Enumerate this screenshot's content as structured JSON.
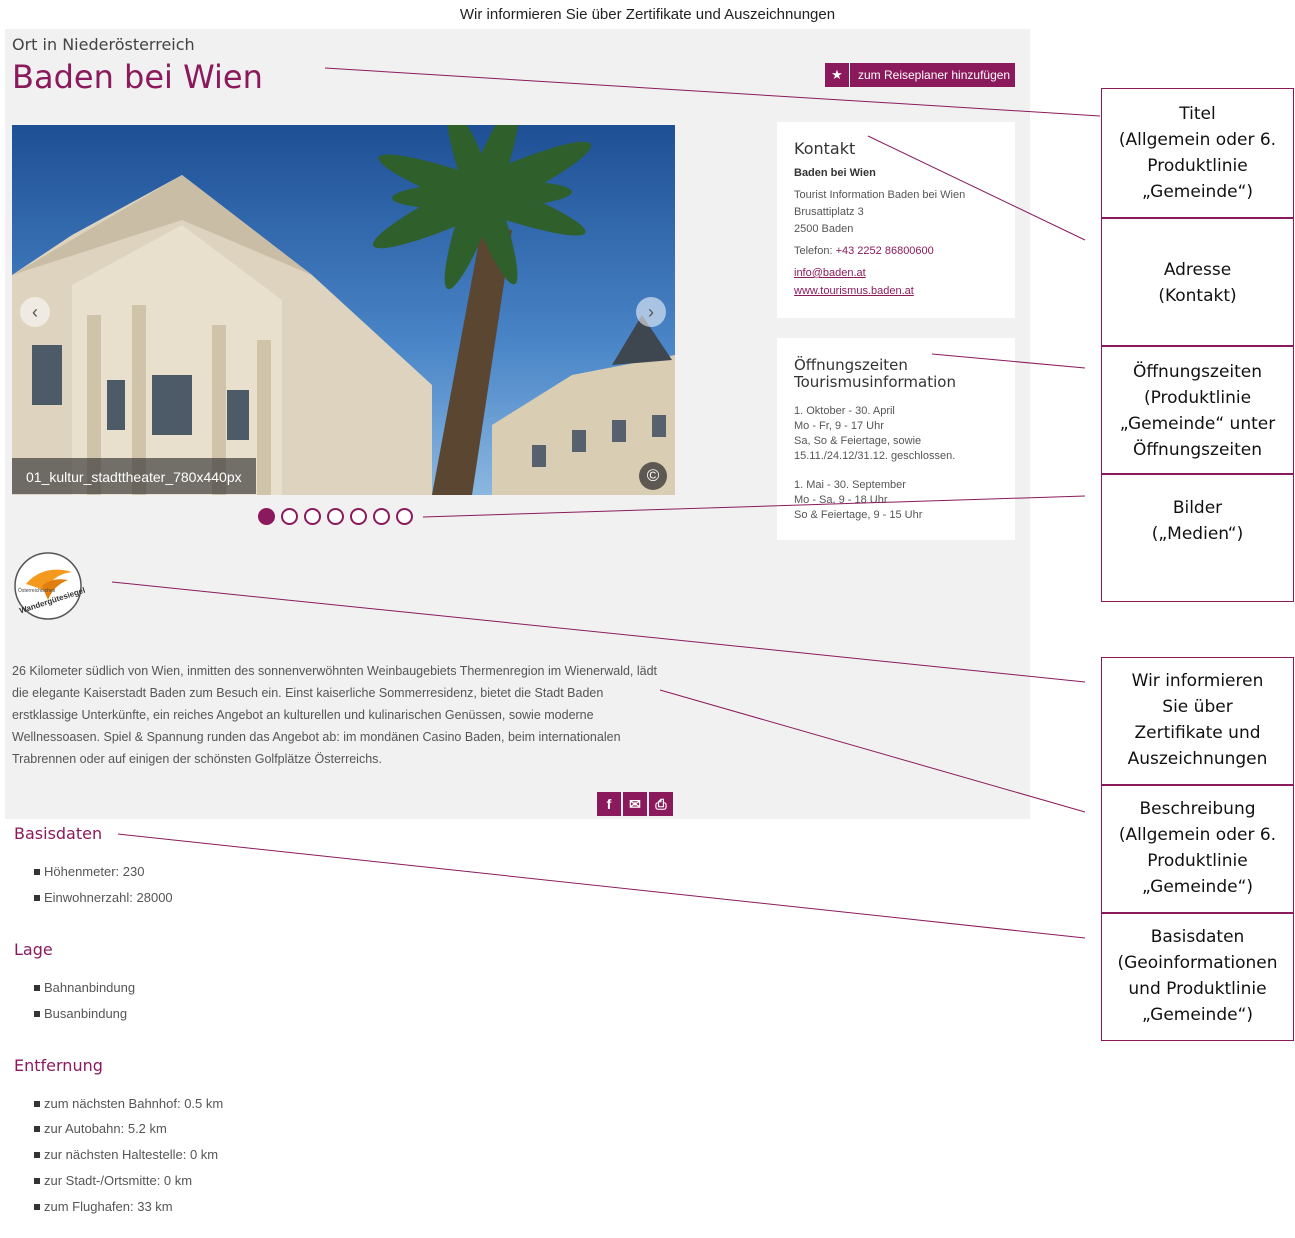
{
  "top_caption": "Wir informieren Sie über Zertifikate und Auszeichnungen",
  "header": {
    "subtitle": "Ort in Niederösterreich",
    "title": "Baden bei Wien",
    "planner_button": "zum Reiseplaner hinzufügen"
  },
  "slider": {
    "caption": "01_kultur_stadttheater_780x440px",
    "copyright": "©",
    "prev": "‹",
    "next": "›",
    "dot_count": 7,
    "active_dot": 1
  },
  "contact": {
    "heading": "Kontakt",
    "name": "Baden bei Wien",
    "org": "Tourist Information Baden bei Wien",
    "street": "Brusattiplatz 3",
    "city": "2500 Baden",
    "phone_label": "Telefon: ",
    "phone": "+43 2252 86800600",
    "email": "info@baden.at",
    "website": "www.tourismus.baden.at"
  },
  "hours": {
    "heading_line1": "Öffnungszeiten",
    "heading_line2": "Tourismusinformation",
    "p1_l1": "1. Oktober - 30. April",
    "p1_l2": "Mo - Fr, 9 - 17 Uhr",
    "p1_l3": "Sa, So & Feiertage, sowie",
    "p1_l4": "15.11./24.12/31.12. geschlossen.",
    "p2_l1": "1. Mai - 30. September",
    "p2_l2": "Mo - Sa, 9 - 18 Uhr",
    "p2_l3": "So & Feiertage, 9 - 15 Uhr"
  },
  "badge": {
    "text_top": "Österreichisches",
    "text_bottom": "Wandergütesiegel"
  },
  "description": "26 Kilometer südlich von Wien, inmitten des sonnenverwöhnten Weinbaugebiets Thermenregion im Wienerwald, lädt die elegante Kaiserstadt Baden zum Besuch ein. Einst kaiserliche Sommerresidenz, bietet die Stadt Baden erstklassige Unterkünfte, ein reiches Angebot an kulturellen und kulinarischen Genüssen, sowie moderne Wellnessoasen. Spiel & Spannung runden das Angebot ab: im mondänen Casino Baden, beim internationalen Trabrennen oder auf einigen der schönsten Golfplätze Österreichs.",
  "share": {
    "facebook": "f",
    "email": "✉",
    "print": "⎙"
  },
  "basisdaten": {
    "title": "Basisdaten",
    "items": [
      "Höhenmeter: 230",
      "Einwohnerzahl: 28000"
    ]
  },
  "lage": {
    "title": "Lage",
    "items": [
      "Bahnanbindung",
      "Busanbindung"
    ]
  },
  "entfernung": {
    "title": "Entfernung",
    "items": [
      "zum nächsten Bahnhof: 0.5 km",
      "zur Autobahn: 5.2 km",
      "zur nächsten Haltestelle: 0 km",
      "zur Stadt-/Ortsmitte: 0 km",
      "zum Flughafen: 33 km"
    ]
  },
  "annotations": [
    {
      "lines": [
        "Titel",
        "(Allgemein oder 6.",
        "Produktlinie",
        "„Gemeinde“)"
      ]
    },
    {
      "lines": [
        "Adresse",
        "(Kontakt)"
      ]
    },
    {
      "lines": [
        "Öffnungszeiten",
        "(Produktlinie",
        "„Gemeinde“ unter",
        "Öffnungszeiten"
      ]
    },
    {
      "lines": [
        "Bilder",
        "(„Medien“)"
      ]
    },
    {
      "lines": [
        "Wir informieren",
        "Sie über",
        "Zertifikate und",
        "Auszeichnungen"
      ]
    },
    {
      "lines": [
        "Beschreibung",
        "(Allgemein oder 6.",
        "Produktlinie",
        "„Gemeinde“)"
      ]
    },
    {
      "lines": [
        "Basisdaten",
        "(Geoinformationen",
        "und Produktlinie",
        "„Gemeinde“)"
      ]
    }
  ],
  "colors": {
    "accent": "#8b1a5c",
    "panel": "#f1f1f1"
  }
}
